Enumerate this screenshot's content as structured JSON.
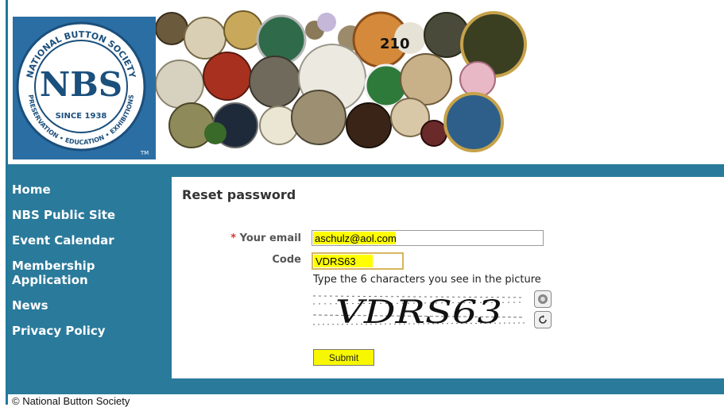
{
  "header": {
    "logo_text": {
      "top": "NATIONAL BUTTON SOCIETY",
      "initials": "NBS",
      "since": "SINCE 1938",
      "bottom": "PRESERVATION • EDUCATION • EXHIBITIONS",
      "tm": "TM"
    },
    "counter": "210"
  },
  "sidebar": {
    "items": [
      {
        "label": "Home"
      },
      {
        "label": "NBS Public Site"
      },
      {
        "label": "Event Calendar"
      },
      {
        "label": "Membership Application"
      },
      {
        "label": "News"
      },
      {
        "label": "Privacy Policy"
      }
    ]
  },
  "form": {
    "title": "Reset password",
    "required_mark": "*",
    "email_label": "Your email",
    "email_value": "aschulz@aol.com",
    "code_label": "Code",
    "code_value": "VDRS63",
    "hint": "Type the 6 characters you see in the picture",
    "captcha_text": "VDRS63",
    "submit_label": "Submit"
  },
  "footer": {
    "text": "© National Button Society"
  },
  "colors": {
    "teal": "#2a7a9b",
    "highlight": "#ffff00",
    "logo_blue": "#2b6ea3"
  }
}
